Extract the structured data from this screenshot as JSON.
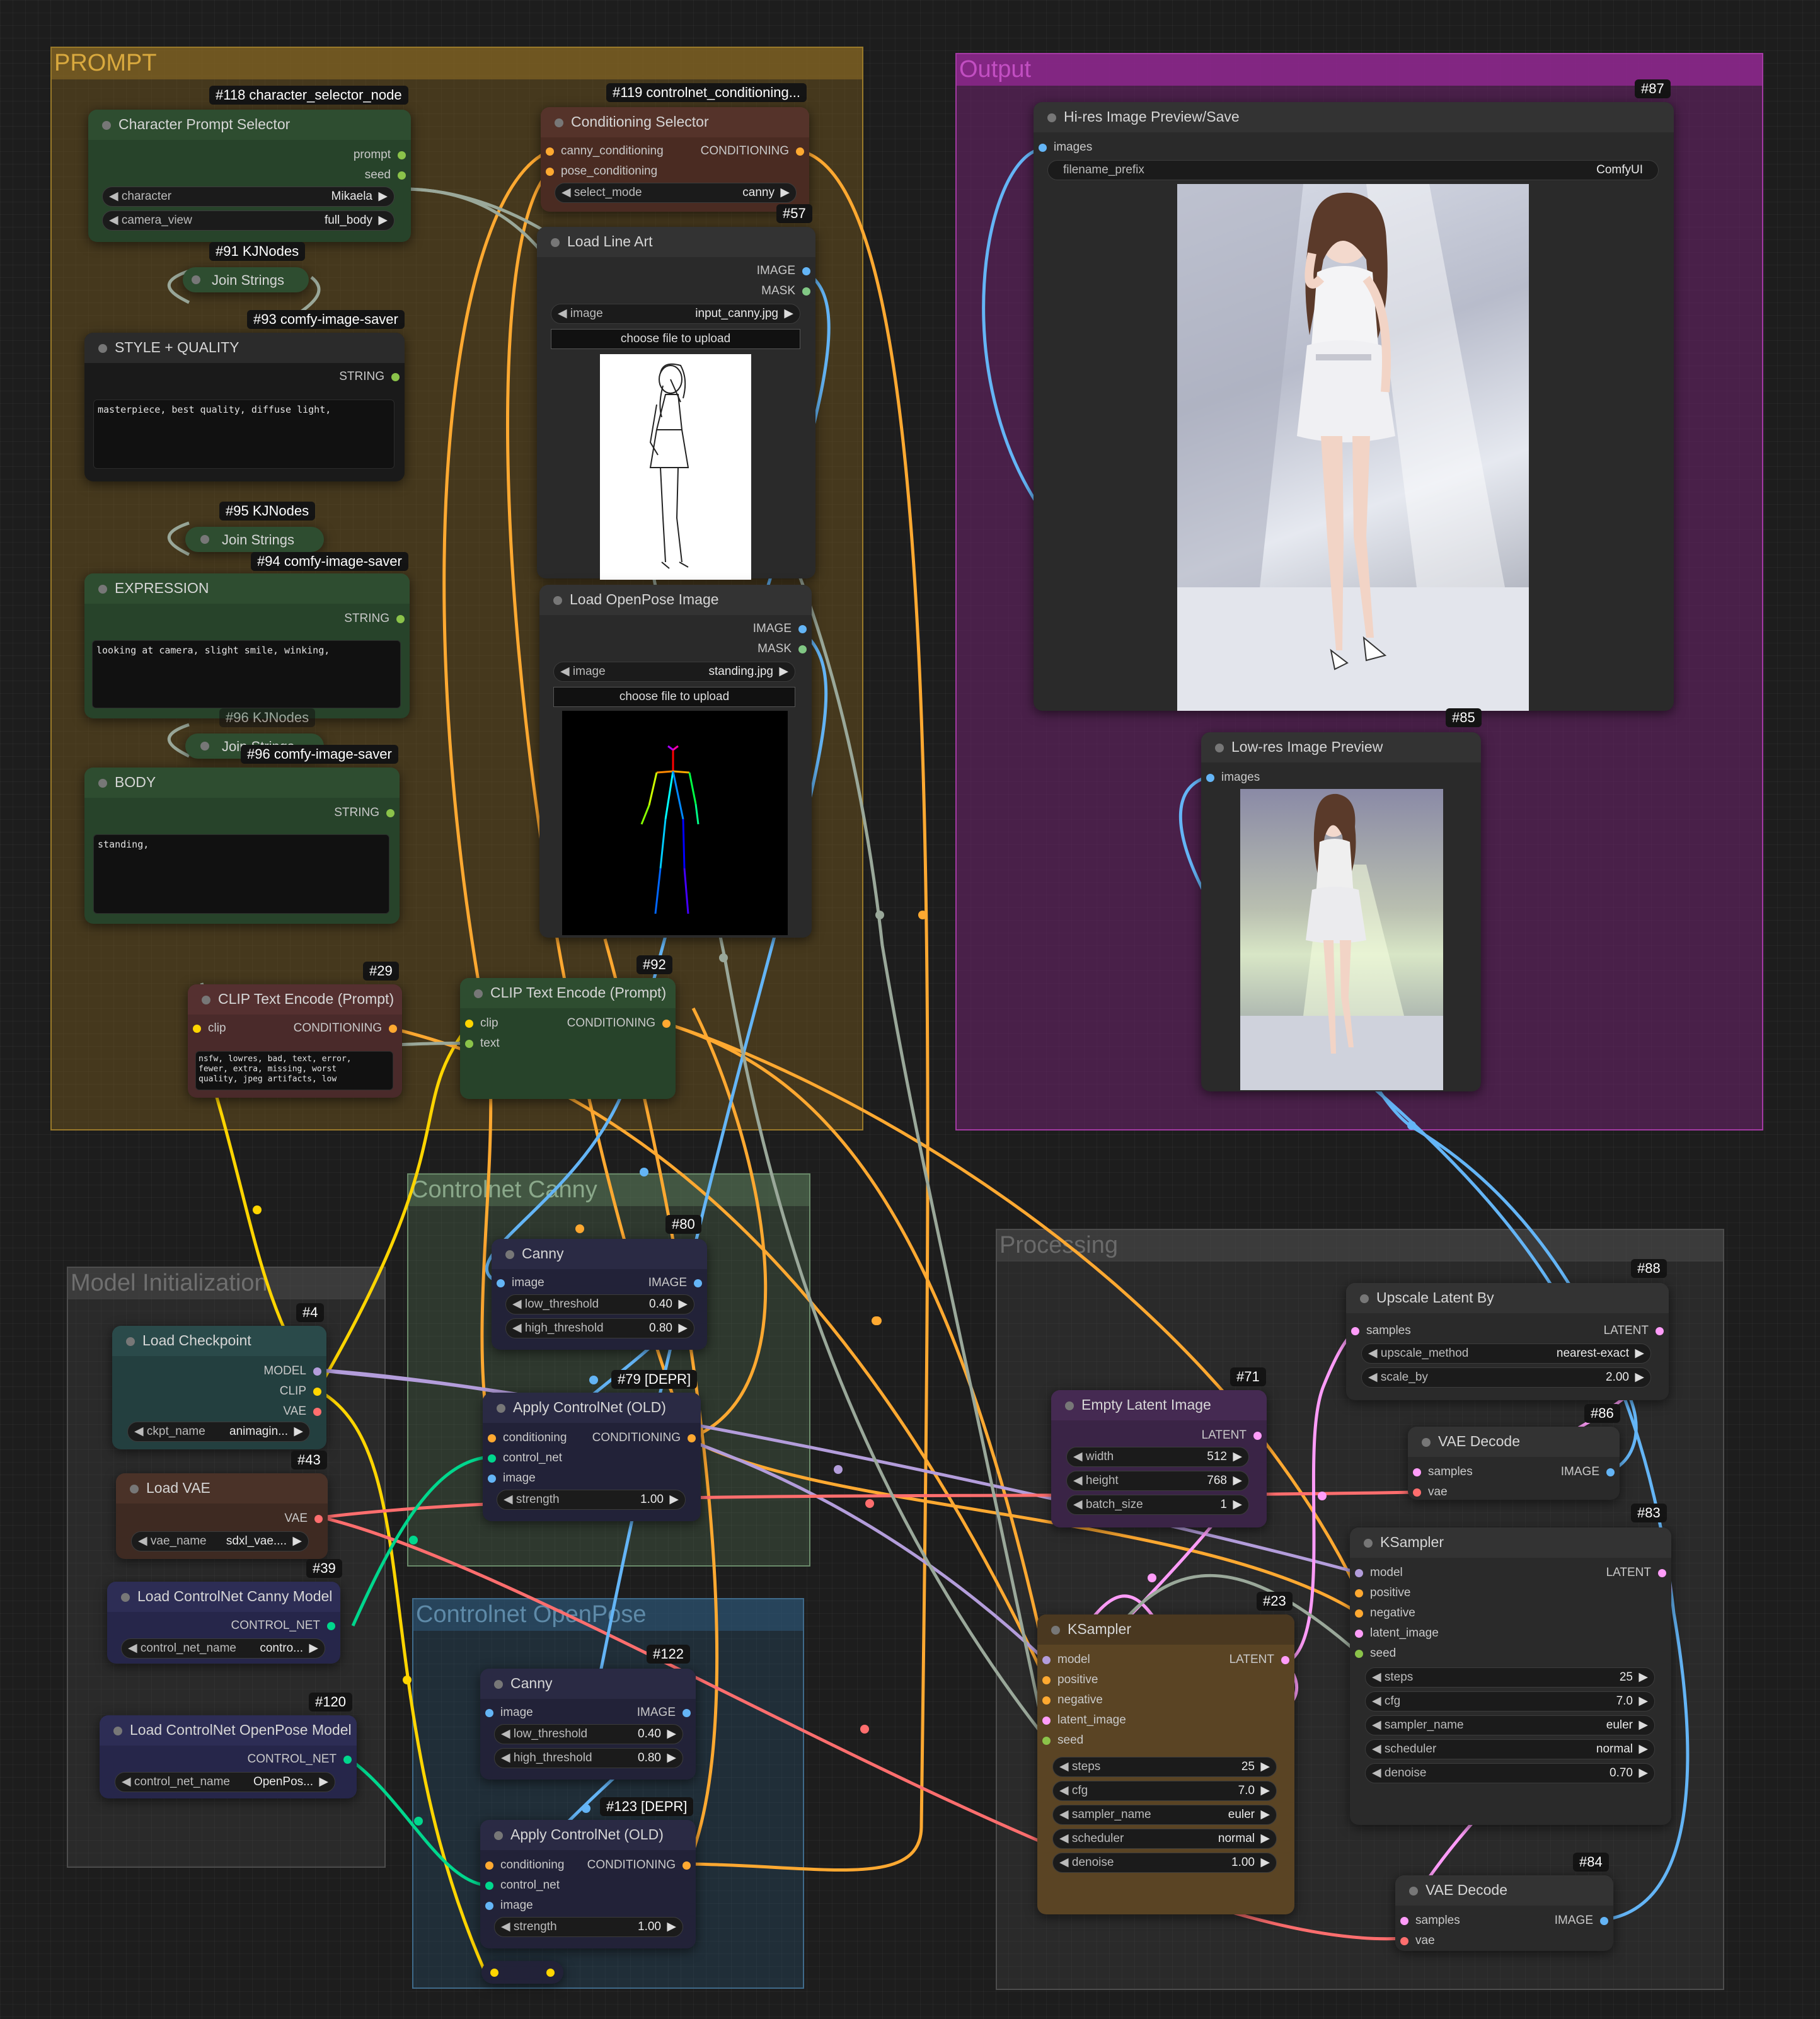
{
  "groups": {
    "prompt": "PROMPT",
    "output": "Output",
    "canny": "Controlnet Canny",
    "openpose": "Controlnet OpenPose",
    "model": "Model Initialization",
    "processing": "Processing"
  },
  "nodes": {
    "charsel": {
      "tag": "#118 character_selector_node",
      "title": "Character Prompt Selector",
      "out_prompt": "prompt",
      "out_seed": "seed",
      "w_character_label": "character",
      "w_character_value": "Mikaela",
      "w_camera_label": "camera_view",
      "w_camera_value": "full_body"
    },
    "join91": {
      "tag": "#91 KJNodes",
      "title": "Join Strings",
      "tag2": "#93 comfy-image-saver"
    },
    "style": {
      "title": "STYLE + QUALITY",
      "out": "STRING",
      "text": "masterpiece, best quality, diffuse light,"
    },
    "join95": {
      "tag": "#95 KJNodes",
      "title": "Join Strings",
      "tag2": "#94 comfy-image-saver"
    },
    "expression": {
      "title": "EXPRESSION",
      "out": "STRING",
      "text": "looking at camera, slight smile, winking,"
    },
    "join96": {
      "tag": "#96 KJNodes",
      "title": "Join Strings",
      "tag2": "#96 comfy-image-saver"
    },
    "body": {
      "title": "BODY",
      "out": "STRING",
      "text": "standing,"
    },
    "condsel": {
      "tag": "#119 controlnet_conditioning...",
      "title": "Conditioning Selector",
      "in1": "canny_conditioning",
      "in2": "pose_conditioning",
      "out": "CONDITIONING",
      "w_label": "select_mode",
      "w_value": "canny"
    },
    "lineart": {
      "tag": "#57",
      "title": "Load Line Art",
      "out1": "IMAGE",
      "out2": "MASK",
      "w_label": "image",
      "w_value": "input_canny.jpg",
      "button": "choose file to upload"
    },
    "openposeimg": {
      "title": "Load OpenPose Image",
      "out1": "IMAGE",
      "out2": "MASK",
      "w_label": "image",
      "w_value": "standing.jpg",
      "button": "choose file to upload"
    },
    "clipneg": {
      "tag": "#29",
      "title": "CLIP Text Encode (Prompt)",
      "in": "clip",
      "out": "CONDITIONING",
      "text": "nsfw, lowres, bad, text, error,\nfewer, extra, missing, worst\nquality, jpeg artifacts, low"
    },
    "clippos": {
      "tag": "#92",
      "title": "CLIP Text Encode (Prompt)",
      "in1": "clip",
      "in2": "text",
      "out": "CONDITIONING"
    },
    "hires": {
      "tag": "#87",
      "title": "Hi-res Image Preview/Save",
      "in": "images",
      "w_label": "filename_prefix",
      "w_value": "ComfyUI"
    },
    "lowres": {
      "tag": "#85",
      "title": "Low-res Image Preview",
      "in": "images"
    },
    "canny80": {
      "tag": "#80",
      "title": "Canny",
      "in": "image",
      "out": "IMAGE",
      "w1_label": "low_threshold",
      "w1_value": "0.40",
      "w2_label": "high_threshold",
      "w2_value": "0.80"
    },
    "apply79": {
      "tag": "#79 [DEPR]",
      "title": "Apply ControlNet (OLD)",
      "in1": "conditioning",
      "in2": "control_net",
      "in3": "image",
      "out": "CONDITIONING",
      "w_label": "strength",
      "w_value": "1.00"
    },
    "canny122": {
      "tag": "#122",
      "title": "Canny",
      "in": "image",
      "out": "IMAGE",
      "w1_label": "low_threshold",
      "w1_value": "0.40",
      "w2_label": "high_threshold",
      "w2_value": "0.80"
    },
    "apply123": {
      "tag": "#123 [DEPR]",
      "title": "Apply ControlNet (OLD)",
      "in1": "conditioning",
      "in2": "control_net",
      "in3": "image",
      "out": "CONDITIONING",
      "w_label": "strength",
      "w_value": "1.00"
    },
    "ckpt": {
      "tag": "#4",
      "title": "Load Checkpoint",
      "out1": "MODEL",
      "out2": "CLIP",
      "out3": "VAE",
      "w_label": "ckpt_name",
      "w_value": "animagin..."
    },
    "vae": {
      "tag": "#43",
      "title": "Load VAE",
      "out": "VAE",
      "w_label": "vae_name",
      "w_value": "sdxl_vae...."
    },
    "cncanny": {
      "tag": "#39",
      "title": "Load ControlNet Canny Model",
      "out": "CONTROL_NET",
      "w_label": "control_net_name",
      "w_value": "contro..."
    },
    "cnpose": {
      "tag": "#120",
      "title": "Load ControlNet OpenPose Model",
      "out": "CONTROL_NET",
      "w_label": "control_net_name",
      "w_value": "OpenPos..."
    },
    "upscale": {
      "tag": "#88",
      "title": "Upscale Latent By",
      "in": "samples",
      "out": "LATENT",
      "w1_label": "upscale_method",
      "w1_value": "nearest-exact",
      "w2_label": "scale_by",
      "w2_value": "2.00"
    },
    "vaedec86": {
      "tag": "#86",
      "title": "VAE Decode",
      "in1": "samples",
      "in2": "vae",
      "out": "IMAGE"
    },
    "empty": {
      "tag": "#71",
      "title": "Empty Latent Image",
      "out": "LATENT",
      "w1_label": "width",
      "w1_value": "512",
      "w2_label": "height",
      "w2_value": "768",
      "w3_label": "batch_size",
      "w3_value": "1"
    },
    "ks83": {
      "tag": "#83",
      "title": "KSampler",
      "in1": "model",
      "in2": "positive",
      "in3": "negative",
      "in4": "latent_image",
      "in5": "seed",
      "out": "LATENT",
      "steps_l": "steps",
      "steps_v": "25",
      "cfg_l": "cfg",
      "cfg_v": "7.0",
      "sampler_l": "sampler_name",
      "sampler_v": "euler",
      "sched_l": "scheduler",
      "sched_v": "normal",
      "denoise_l": "denoise",
      "denoise_v": "0.70"
    },
    "ks23": {
      "tag": "#23",
      "title": "KSampler",
      "in1": "model",
      "in2": "positive",
      "in3": "negative",
      "in4": "latent_image",
      "in5": "seed",
      "out": "LATENT",
      "steps_l": "steps",
      "steps_v": "25",
      "cfg_l": "cfg",
      "cfg_v": "7.0",
      "sampler_l": "sampler_name",
      "sampler_v": "euler",
      "sched_l": "scheduler",
      "sched_v": "normal",
      "denoise_l": "denoise",
      "denoise_v": "1.00"
    },
    "vaedec84": {
      "tag": "#84",
      "title": "VAE Decode",
      "in1": "samples",
      "in2": "vae",
      "out": "IMAGE"
    }
  },
  "colors": {
    "clip": "#ffd500",
    "conditioning": "#ffa931",
    "model": "#b39ddb",
    "vae": "#ff6e6e",
    "control_net": "#00d78d",
    "image": "#64b5f6",
    "latent": "#ff9cf9",
    "string": "#8bc34a",
    "int": "#a0c4a0"
  }
}
